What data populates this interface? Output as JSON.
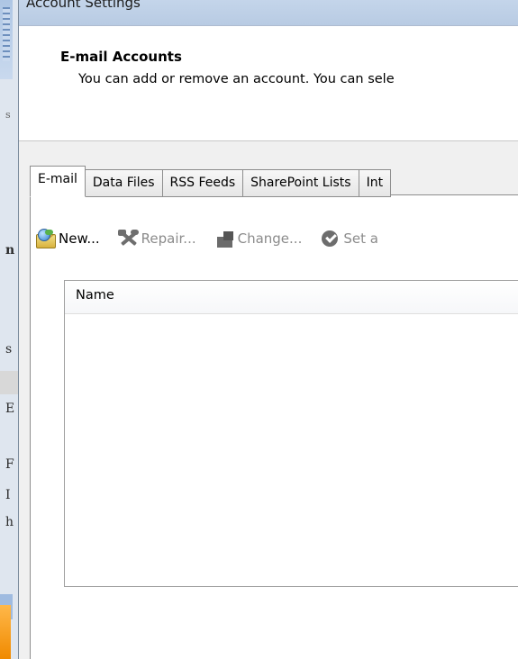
{
  "window": {
    "title": "Account Settings"
  },
  "header": {
    "title": "E-mail Accounts",
    "description": "You can add or remove an account. You can sele"
  },
  "tabs": [
    {
      "label": "E-mail",
      "active": true
    },
    {
      "label": "Data Files",
      "active": false
    },
    {
      "label": "RSS Feeds",
      "active": false
    },
    {
      "label": "SharePoint Lists",
      "active": false
    },
    {
      "label": "Int",
      "active": false
    }
  ],
  "toolbar": {
    "new_label": "New...",
    "repair_label": "Repair...",
    "change_label": "Change...",
    "set_default_label": "Set a"
  },
  "list": {
    "columns": [
      "Name"
    ]
  },
  "background_fragments": [
    "s",
    "n",
    "s",
    "E",
    "F",
    "I",
    "h"
  ]
}
